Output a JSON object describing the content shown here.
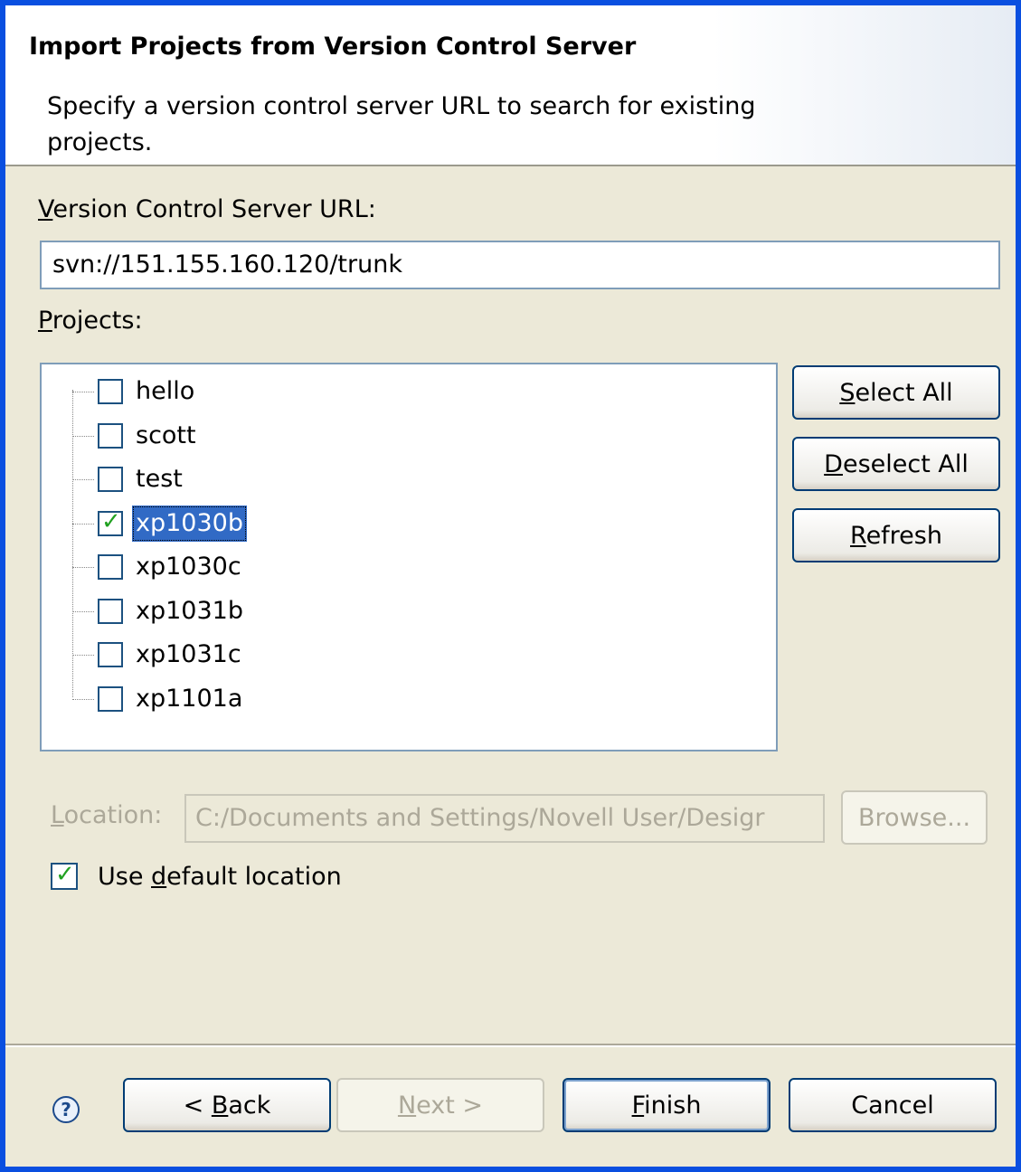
{
  "header": {
    "title": "Import Projects from Version Control Server",
    "description": "Specify a version control server URL to search for existing projects."
  },
  "url_section": {
    "label": "Version Control Server URL:",
    "value": "svn://151.155.160.120/trunk"
  },
  "projects_section": {
    "label": "Projects:",
    "items": [
      {
        "label": "hello",
        "checked": false,
        "selected": false
      },
      {
        "label": "scott",
        "checked": false,
        "selected": false
      },
      {
        "label": "test",
        "checked": false,
        "selected": false
      },
      {
        "label": "xp1030b",
        "checked": true,
        "selected": true
      },
      {
        "label": "xp1030c",
        "checked": false,
        "selected": false
      },
      {
        "label": "xp1031b",
        "checked": false,
        "selected": false
      },
      {
        "label": "xp1031c",
        "checked": false,
        "selected": false
      },
      {
        "label": "xp1101a",
        "checked": false,
        "selected": false
      }
    ],
    "select_all_label": "Select All",
    "deselect_all_label": "Deselect All",
    "refresh_label": "Refresh"
  },
  "location": {
    "label": "Location:",
    "value": "C:/Documents and Settings/Novell User/Desigr",
    "browse_label": "Browse...",
    "use_default_label": "Use default location",
    "use_default_checked": true
  },
  "footer": {
    "back_label": "< Back",
    "next_label": "Next >",
    "finish_label": "Finish",
    "cancel_label": "Cancel",
    "help_icon": "help-icon"
  },
  "colors": {
    "window_border": "#0a4fe0",
    "dialog_bg": "#ece9d8",
    "selection": "#316ac5",
    "check": "#21a121"
  }
}
